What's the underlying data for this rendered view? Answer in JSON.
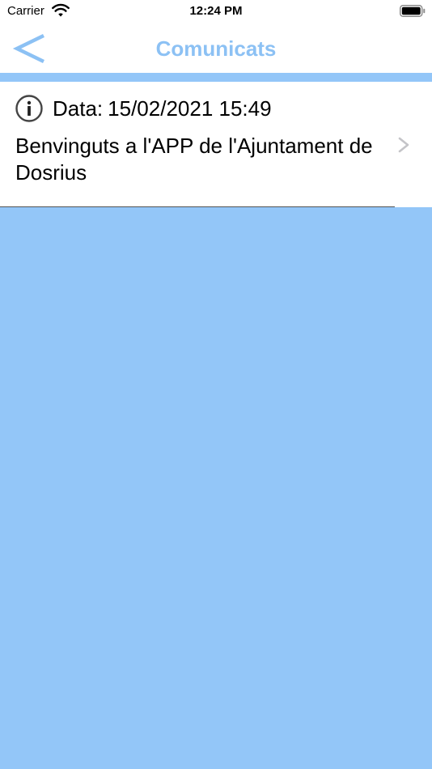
{
  "status_bar": {
    "carrier": "Carrier",
    "time": "12:24 PM",
    "wifi_icon": "wifi-icon",
    "battery_icon": "battery-icon"
  },
  "nav_bar": {
    "title": "Comunicats",
    "back_icon": "chevron-left-icon",
    "title_color": "#8cc1f4"
  },
  "messages": [
    {
      "date_label": "Data:",
      "date": "15/02/2021 15:49",
      "title": "Benvinguts a l'APP de l'Ajuntament de Dosrius",
      "icon": "info-icon",
      "disclosure_icon": "chevron-right-icon"
    }
  ],
  "colors": {
    "background": "#93c6f8",
    "accent": "#8cc1f4"
  }
}
